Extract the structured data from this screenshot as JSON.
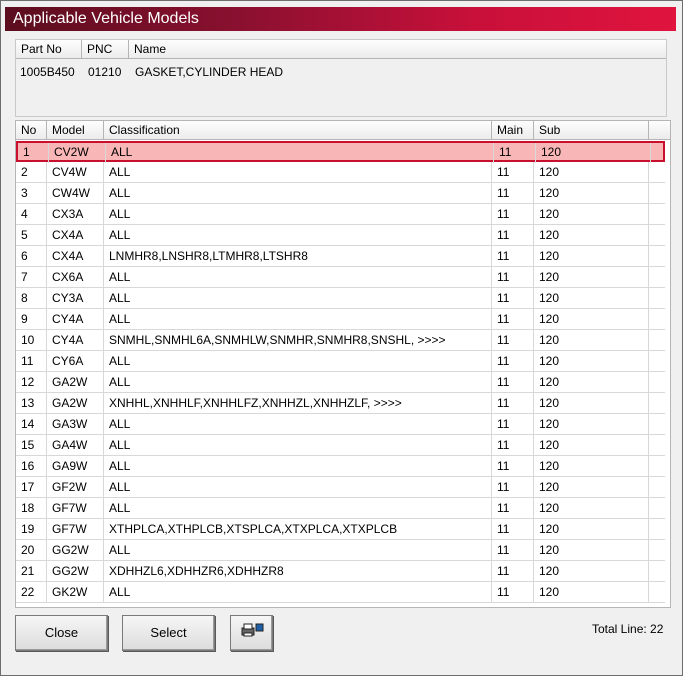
{
  "window": {
    "title": "Applicable Vehicle Models"
  },
  "part": {
    "headers": [
      "Part No",
      "PNC",
      "Name"
    ],
    "part_no": "1005B450",
    "pnc": "01210",
    "name": "GASKET,CYLINDER HEAD"
  },
  "table": {
    "headers": [
      "No",
      "Model",
      "Classification",
      "Main",
      "Sub"
    ],
    "rows": [
      [
        "1",
        "CV2W",
        "ALL",
        "11",
        "120"
      ],
      [
        "2",
        "CV4W",
        "ALL",
        "11",
        "120"
      ],
      [
        "3",
        "CW4W",
        "ALL",
        "11",
        "120"
      ],
      [
        "4",
        "CX3A",
        "ALL",
        "11",
        "120"
      ],
      [
        "5",
        "CX4A",
        "ALL",
        "11",
        "120"
      ],
      [
        "6",
        "CX4A",
        "LNMHR8,LNSHR8,LTMHR8,LTSHR8",
        "11",
        "120"
      ],
      [
        "7",
        "CX6A",
        "ALL",
        "11",
        "120"
      ],
      [
        "8",
        "CY3A",
        "ALL",
        "11",
        "120"
      ],
      [
        "9",
        "CY4A",
        "ALL",
        "11",
        "120"
      ],
      [
        "10",
        "CY4A",
        "SNMHL,SNMHL6A,SNMHLW,SNMHR,SNMHR8,SNSHL,  >>>>",
        "11",
        "120"
      ],
      [
        "11",
        "CY6A",
        "ALL",
        "11",
        "120"
      ],
      [
        "12",
        "GA2W",
        "ALL",
        "11",
        "120"
      ],
      [
        "13",
        "GA2W",
        "XNHHL,XNHHLF,XNHHLFZ,XNHHZL,XNHHZLF,  >>>>",
        "11",
        "120"
      ],
      [
        "14",
        "GA3W",
        "ALL",
        "11",
        "120"
      ],
      [
        "15",
        "GA4W",
        "ALL",
        "11",
        "120"
      ],
      [
        "16",
        "GA9W",
        "ALL",
        "11",
        "120"
      ],
      [
        "17",
        "GF2W",
        "ALL",
        "11",
        "120"
      ],
      [
        "18",
        "GF7W",
        "ALL",
        "11",
        "120"
      ],
      [
        "19",
        "GF7W",
        "XTHPLCA,XTHPLCB,XTSPLCA,XTXPLCA,XTXPLCB",
        "11",
        "120"
      ],
      [
        "20",
        "GG2W",
        "ALL",
        "11",
        "120"
      ],
      [
        "21",
        "GG2W",
        "XDHHZL6,XDHHZR6,XDHHZR8",
        "11",
        "120"
      ],
      [
        "22",
        "GK2W",
        "ALL",
        "11",
        "120"
      ]
    ],
    "selected_index": 0
  },
  "buttons": {
    "close": "Close",
    "select": "Select",
    "print_icon": "printer-icon"
  },
  "footer": {
    "total_label": "Total Line: 22"
  },
  "colors": {
    "title_start": "#5b0d1e",
    "title_end": "#e0143e",
    "selected_fill": "#f9b6b6",
    "selected_border": "#c8102e"
  }
}
